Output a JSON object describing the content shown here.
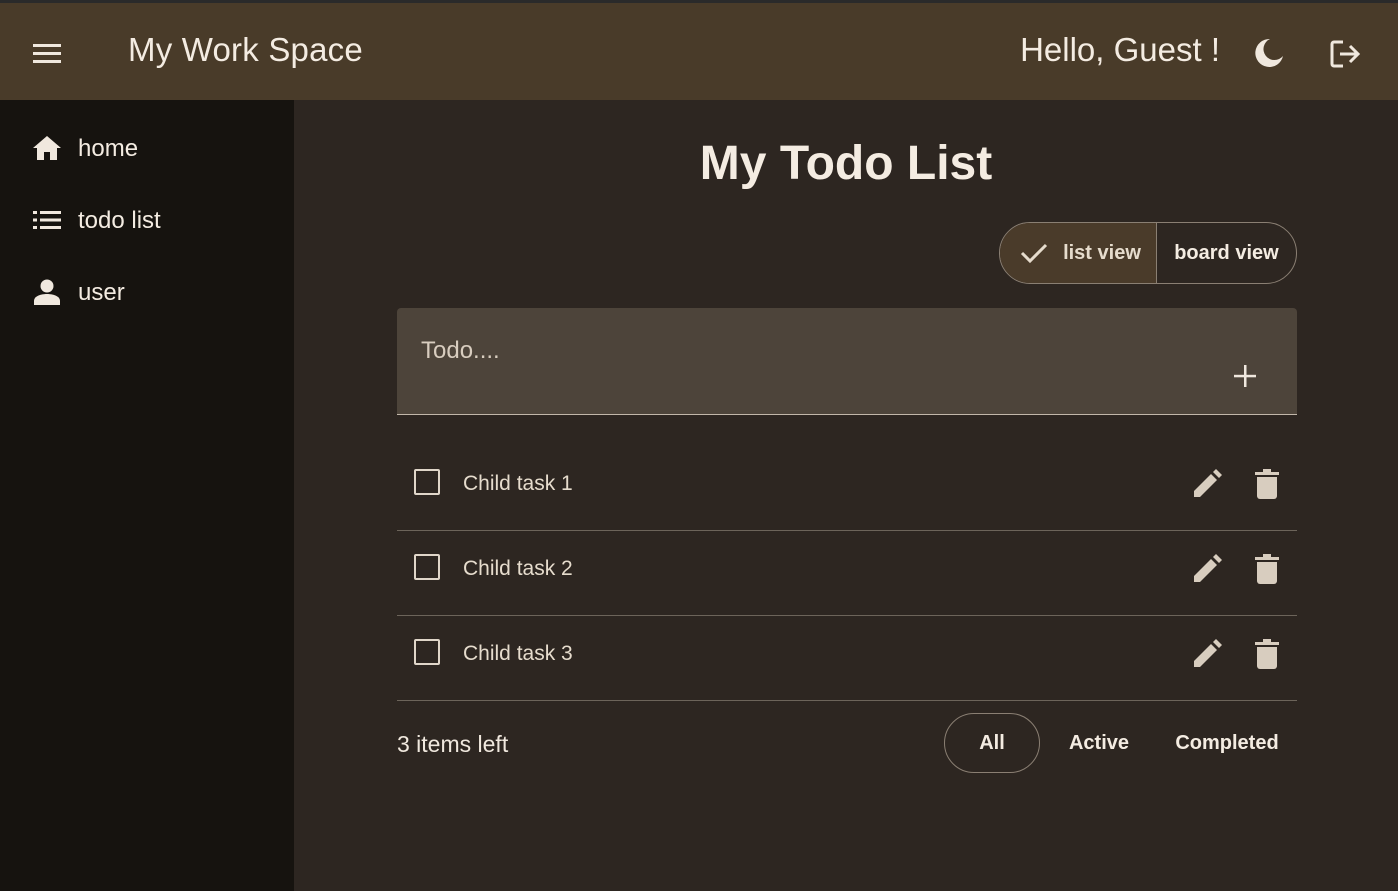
{
  "header": {
    "title": "My Work Space",
    "greeting": "Hello, Guest !",
    "icons": [
      "menu-icon",
      "dark-mode-icon",
      "logout-icon"
    ]
  },
  "sidebar": {
    "items": [
      {
        "label": "home",
        "icon": "home-icon"
      },
      {
        "label": "todo list",
        "icon": "list-icon"
      },
      {
        "label": "user",
        "icon": "person-icon"
      }
    ]
  },
  "main": {
    "title": "My Todo List",
    "view_toggle": {
      "list": "list view",
      "board": "board view",
      "selected": "list view"
    },
    "input": {
      "placeholder": "Todo....",
      "value": ""
    },
    "tasks": [
      {
        "text": "Child task 1",
        "done": false
      },
      {
        "text": "Child task 2",
        "done": false
      },
      {
        "text": "Child task 3",
        "done": false
      }
    ],
    "footer": {
      "count": "3 items left",
      "filters": [
        "All",
        "Active",
        "Completed"
      ],
      "selected_filter": "All"
    }
  },
  "colors": {
    "appbar": "#493b29",
    "sidebar": "#16130f",
    "background": "#2d2621",
    "input": "#4d443a",
    "text": "#f4ece2"
  }
}
